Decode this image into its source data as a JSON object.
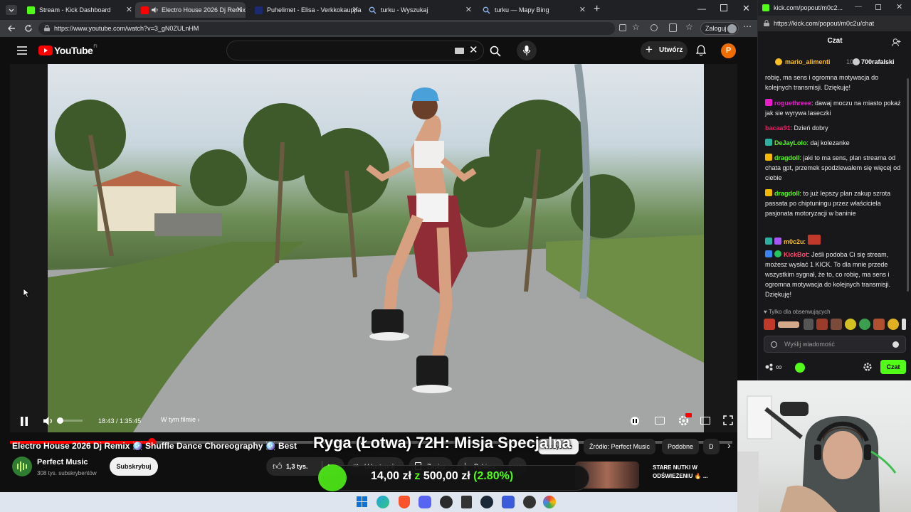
{
  "browser": {
    "tabs": [
      {
        "title": "Stream - Kick Dashboard",
        "color": "#53fc18",
        "active": false
      },
      {
        "title": "Electro House 2026 Dj Remix",
        "color": "#ff0000",
        "active": true
      },
      {
        "title": "Puhelimet - Elisa - Verkkokauppa",
        "color": "#1c2a6f",
        "active": false
      },
      {
        "title": "turku - Wyszukaj",
        "color": "#3b82f6",
        "active": false
      },
      {
        "title": "turku — Mapy Bing",
        "color": "#3b82f6",
        "active": false
      }
    ],
    "url": "https://www.youtube.com/watch?v=3_gN0ZULnHM",
    "login_label": "Zaloguj"
  },
  "youtube": {
    "logo_text": "YouTube",
    "logo_sup": "FI",
    "create_label": "Utwórz",
    "avatar_letter": "P",
    "time_current": "18:43",
    "time_total": "1:35:45",
    "chapter_label": "W tym filmie",
    "progress_fraction": 0.196,
    "video_title": "Electro House 2026 Dj Remix 🪩 Shuffle Dance Choreography 🪩 Best",
    "channel_name": "Perfect Music",
    "subscribers": "308 tys. subskrybentów",
    "subscribe_label": "Subskrybuj",
    "likes": "1,3 tys.",
    "share_label": "Udostępnij",
    "save_label": "Zapisz",
    "download_label": "Pobierz",
    "chips": [
      "Wszystkie",
      "Źródło: Perfect Music",
      "Podobne",
      "D"
    ],
    "rec_title_1": "STARE NUTKI W",
    "rec_title_2": "ODŚWIEŻENIU 🔥 ..."
  },
  "overlay": {
    "title": "Ryga (Łotwa) 72H: Misja Specjalna",
    "amount": "14,00 zł",
    "separator": "z",
    "goal": "500,00 zł",
    "percent": "(2.80%)",
    "fraction": 0.028
  },
  "chat": {
    "window_url": "kick.com/popout/m0c2...",
    "url": "https://kick.com/popout/m0c2u/chat",
    "header": "Czat",
    "pinned_users": [
      "mario_alimenti",
      "700rafalski"
    ],
    "pinned_count": "10",
    "messages": [
      {
        "user": "",
        "color": "#eaeaea",
        "text": "robię, ma sens i ogromna motywacja do kolejnych transmisji. Dziękuję!"
      },
      {
        "user": "roguethreee",
        "color": "#e91ec9",
        "text": "dawaj moczu na miasto pokaż jak sie wyrywa laseczki"
      },
      {
        "user": "bacaa91",
        "color": "#e91e63",
        "text": "Dzień dobry"
      },
      {
        "user": "DeJayLolo",
        "color": "#53fc18",
        "text": "daj kolezanke"
      },
      {
        "user": "dragdoll",
        "color": "#53fc18",
        "text": "jaki to ma sens, plan streama od chata gpt, przemek spodziewałem się więcej od ciebie"
      },
      {
        "user": "dragdoll",
        "color": "#53fc18",
        "text": "to już lepszy plan zakup szrota passata po chiptuningu przez właściciela pasjonata motoryzacji w baninie"
      },
      {
        "user": "m0c2u",
        "color": "#fbbf24",
        "text": ""
      },
      {
        "user": "KickBot",
        "color": "#ff4d6d",
        "text": "Jeśli podoba Ci się stream, możesz wysłać 1 KICK. To dla mnie przede wszystkim sygnał, że to, co robię, ma sens i ogromna motywacja do kolejnych transmisji. Dziękuję!"
      }
    ],
    "followers_only": "Tylko dla obserwujących",
    "input_placeholder": "Wyślij wiadomość",
    "send_label": "Czat"
  }
}
